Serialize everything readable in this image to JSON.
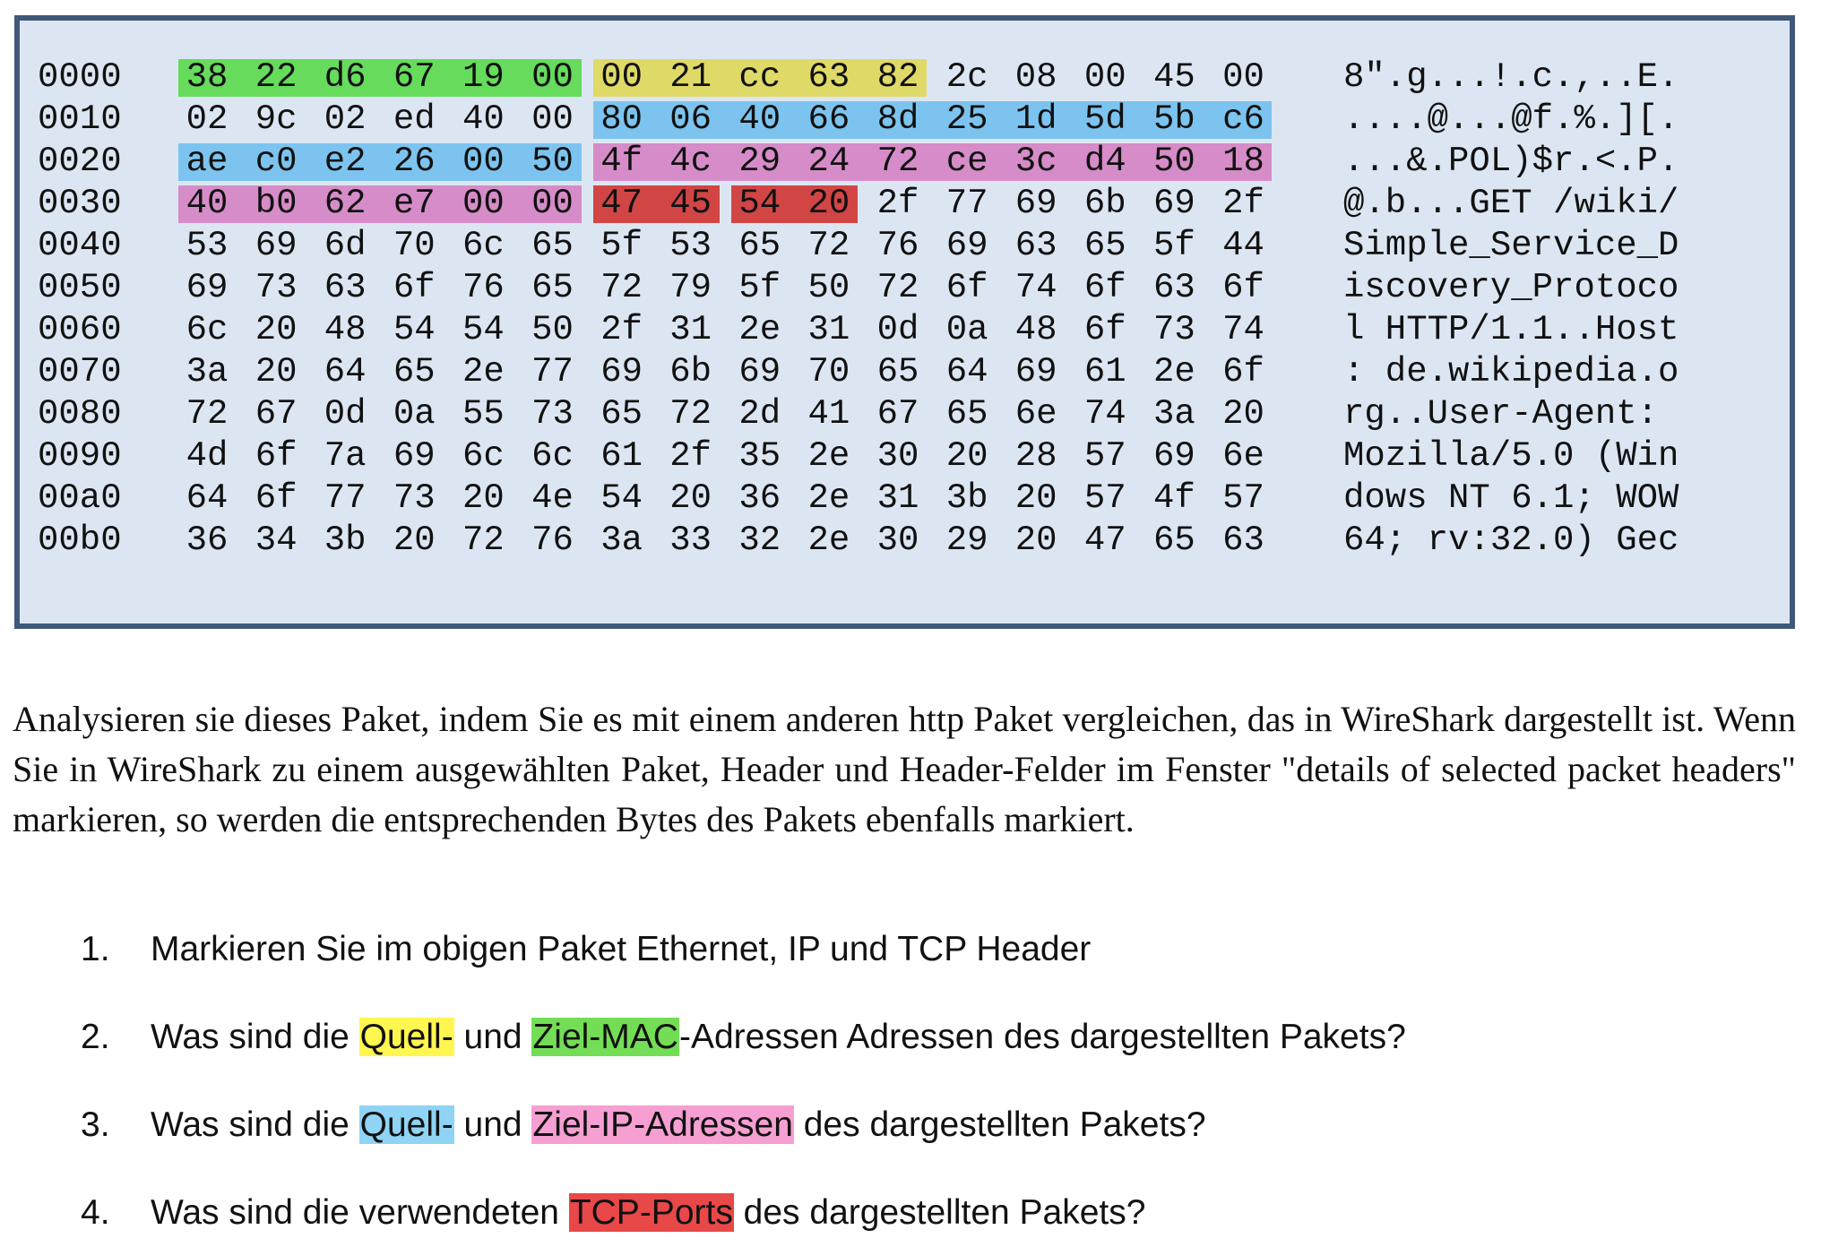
{
  "hex_dump": {
    "rows": [
      {
        "offset": "0000",
        "bytes": [
          "38",
          "22",
          "d6",
          "67",
          "19",
          "00",
          "00",
          "21",
          "cc",
          "63",
          "82",
          "2c",
          "08",
          "00",
          "45",
          "00"
        ],
        "ascii": "8\".g...!.c.,..E."
      },
      {
        "offset": "0010",
        "bytes": [
          "02",
          "9c",
          "02",
          "ed",
          "40",
          "00",
          "80",
          "06",
          "40",
          "66",
          "8d",
          "25",
          "1d",
          "5d",
          "5b",
          "c6"
        ],
        "ascii": "....@...@f.%.][."
      },
      {
        "offset": "0020",
        "bytes": [
          "ae",
          "c0",
          "e2",
          "26",
          "00",
          "50",
          "4f",
          "4c",
          "29",
          "24",
          "72",
          "ce",
          "3c",
          "d4",
          "50",
          "18"
        ],
        "ascii": "...&.POL)$r.<.P."
      },
      {
        "offset": "0030",
        "bytes": [
          "40",
          "b0",
          "62",
          "e7",
          "00",
          "00",
          "47",
          "45",
          "54",
          "20",
          "2f",
          "77",
          "69",
          "6b",
          "69",
          "2f"
        ],
        "ascii": "@.b...GET /wiki/"
      },
      {
        "offset": "0040",
        "bytes": [
          "53",
          "69",
          "6d",
          "70",
          "6c",
          "65",
          "5f",
          "53",
          "65",
          "72",
          "76",
          "69",
          "63",
          "65",
          "5f",
          "44"
        ],
        "ascii": "Simple_Service_D"
      },
      {
        "offset": "0050",
        "bytes": [
          "69",
          "73",
          "63",
          "6f",
          "76",
          "65",
          "72",
          "79",
          "5f",
          "50",
          "72",
          "6f",
          "74",
          "6f",
          "63",
          "6f"
        ],
        "ascii": "iscovery_Protoco"
      },
      {
        "offset": "0060",
        "bytes": [
          "6c",
          "20",
          "48",
          "54",
          "54",
          "50",
          "2f",
          "31",
          "2e",
          "31",
          "0d",
          "0a",
          "48",
          "6f",
          "73",
          "74"
        ],
        "ascii": "l HTTP/1.1..Host"
      },
      {
        "offset": "0070",
        "bytes": [
          "3a",
          "20",
          "64",
          "65",
          "2e",
          "77",
          "69",
          "6b",
          "69",
          "70",
          "65",
          "64",
          "69",
          "61",
          "2e",
          "6f"
        ],
        "ascii": ": de.wikipedia.o"
      },
      {
        "offset": "0080",
        "bytes": [
          "72",
          "67",
          "0d",
          "0a",
          "55",
          "73",
          "65",
          "72",
          "2d",
          "41",
          "67",
          "65",
          "6e",
          "74",
          "3a",
          "20"
        ],
        "ascii": "rg..User-Agent: "
      },
      {
        "offset": "0090",
        "bytes": [
          "4d",
          "6f",
          "7a",
          "69",
          "6c",
          "6c",
          "61",
          "2f",
          "35",
          "2e",
          "30",
          "20",
          "28",
          "57",
          "69",
          "6e"
        ],
        "ascii": "Mozilla/5.0 (Win"
      },
      {
        "offset": "00a0",
        "bytes": [
          "64",
          "6f",
          "77",
          "73",
          "20",
          "4e",
          "54",
          "20",
          "36",
          "2e",
          "31",
          "3b",
          "20",
          "57",
          "4f",
          "57"
        ],
        "ascii": "dows NT 6.1; WOW"
      },
      {
        "offset": "00b0",
        "bytes": [
          "36",
          "34",
          "3b",
          "20",
          "72",
          "76",
          "3a",
          "33",
          "32",
          "2e",
          "30",
          "29",
          "20",
          "47",
          "65",
          "63"
        ],
        "ascii": "64; rv:32.0) Gec"
      }
    ],
    "highlight_colors": {
      "green": "#66db5c",
      "yellow": "#dfd968",
      "blue": "#7cc4ef",
      "pink": "#d68cc8",
      "red": "#d14545"
    }
  },
  "description": "Analysieren sie dieses Paket, indem Sie es mit einem anderen http Paket vergleichen, das in WireShark dargestellt ist. Wenn Sie in WireShark zu einem ausgewählten Paket, Header und Header-Felder im Fenster \"details of selected packet headers\" markieren, so werden die entsprechenden Bytes des Pakets ebenfalls markiert.",
  "questions": [
    {
      "number": "1.",
      "parts": [
        {
          "text": "Markieren Sie im obigen Paket Ethernet, IP und TCP Header"
        }
      ]
    },
    {
      "number": "2.",
      "parts": [
        {
          "text": "Was sind die "
        },
        {
          "text": "Quell-",
          "mark": "yellow"
        },
        {
          "text": " und "
        },
        {
          "text": "Ziel-MAC",
          "mark": "green"
        },
        {
          "text": "-Adressen Adressen des dargestellten Pakets?"
        }
      ]
    },
    {
      "number": "3.",
      "parts": [
        {
          "text": "Was sind die "
        },
        {
          "text": "Quell-",
          "mark": "blue"
        },
        {
          "text": " und "
        },
        {
          "text": "Ziel-IP-Adressen",
          "mark": "pink"
        },
        {
          "text": " des dargestellten Pakets?"
        }
      ]
    },
    {
      "number": "4.",
      "parts": [
        {
          "text": "Was sind die verwendeten "
        },
        {
          "text": "TCP-Ports",
          "mark": "red"
        },
        {
          "text": " des dargestellten Pakets?"
        }
      ]
    }
  ]
}
